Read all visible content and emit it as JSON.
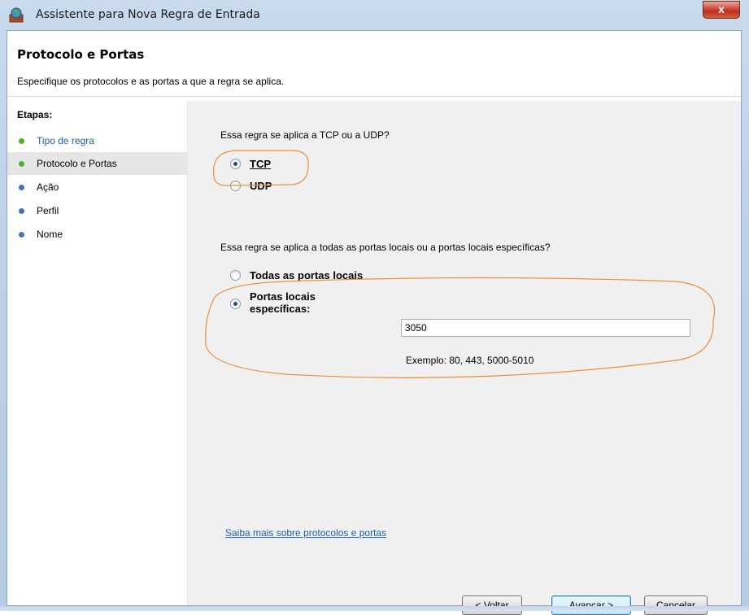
{
  "window": {
    "title": "Assistente para Nova Regra de Entrada",
    "close_label": "x"
  },
  "header": {
    "title": "Protocolo e Portas",
    "description": "Especifique os protocolos e as portas a que a regra se aplica."
  },
  "sidebar": {
    "title": "Etapas:",
    "items": [
      {
        "label": "Tipo de regra",
        "state": "completed"
      },
      {
        "label": "Protocolo e Portas",
        "state": "current"
      },
      {
        "label": "Ação",
        "state": "pending"
      },
      {
        "label": "Perfil",
        "state": "pending"
      },
      {
        "label": "Nome",
        "state": "pending"
      }
    ]
  },
  "protocol": {
    "question": "Essa regra se aplica a TCP ou a UDP?",
    "options": [
      {
        "label": "TCP",
        "selected": true
      },
      {
        "label": "UDP",
        "selected": false
      }
    ]
  },
  "ports": {
    "question": "Essa regra se aplica a todas as portas locais ou a portas locais específicas?",
    "all_label": "Todas as portas locais",
    "specific_label_line1": "Portas locais",
    "specific_label_line2": "específicas:",
    "selected": "specific",
    "value": "3050",
    "example": "Exemplo: 80, 443, 5000-5010"
  },
  "help_link": "Saiba mais sobre protocolos e portas",
  "buttons": {
    "back": "< Voltar",
    "next": "Avançar >",
    "cancel": "Cancelar"
  },
  "colors": {
    "completed_bullet": "#4caf2a",
    "pending_bullet": "#4a6fb5",
    "annotation": "#e8903a",
    "link": "#1f5fae"
  }
}
